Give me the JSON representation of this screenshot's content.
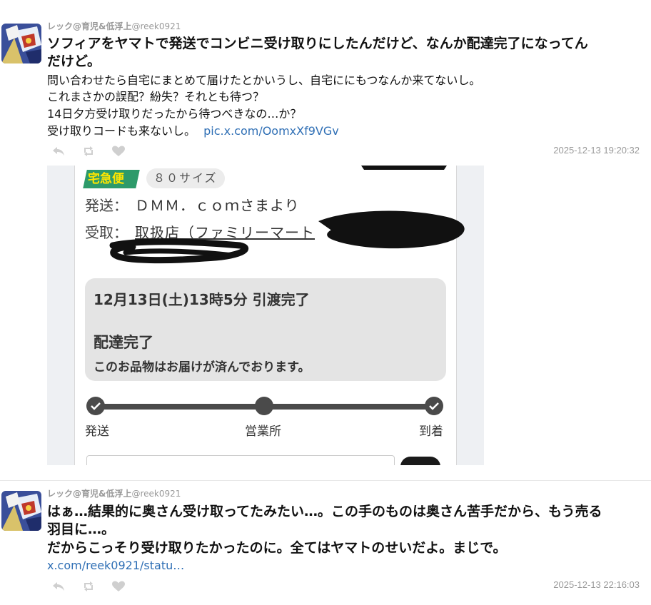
{
  "tweets": [
    {
      "author_name": "レック@育児&低浮上",
      "author_handle": "@reek0921",
      "bold_text_1": "ソフィアをヤマトで発送でコンビニ受け取りにしたんだけど、なんか配達完了になってん",
      "bold_text_2": "だけど。",
      "lines": [
        "問い合わせたら自宅にまとめて届けたとかいうし、自宅ににもつなんか来てないし。",
        "これまさかの誤配？紛失？それとも待つ？",
        "14日夕方受け取りだったから待つべきなの…か？"
      ],
      "last_line_text": "受け取りコードも来ないし。",
      "link": "pic.x.com/OomxXf9VGv",
      "timestamp": "2025-12-13 19:20:32",
      "actions": [
        "reply-icon",
        "retweet-icon",
        "like-icon"
      ]
    },
    {
      "author_name": "レック@育児&低浮上",
      "author_handle": "@reek0921",
      "bold_text_1": "はぁ…結果的に奥さん受け取ってたみたい…。この手のものは奥さん苦手だから、もう売る",
      "bold_text_2": "羽目に…。",
      "bold_text_3": "だからこっそり受け取りたかったのに。全てはヤマトのせいだよ。まじで。",
      "link": "x.com/reek0921/statu…",
      "timestamp": "2025-12-13 22:16:03",
      "actions": [
        "reply-icon",
        "retweet-icon",
        "like-icon"
      ]
    }
  ],
  "screenshot": {
    "badge": "宅急便",
    "size": "８０サイズ",
    "send_label": "発送：",
    "send_value": "ＤＭＭ．ｃｏｍさまより",
    "receive_label": "受取：",
    "receive_value": "取扱店（ファミリーマート",
    "status_time": "12月13日(土)13時5分 引渡完了",
    "status_main": "配達完了",
    "status_sub": "このお品物はお届けが済んでおります。",
    "steps": [
      "発送",
      "営業所",
      "到着"
    ],
    "progress_fraction": 1.0
  },
  "colors": {
    "link": "#2f6fb5",
    "badge_bg": "#2d9a6a",
    "badge_text": "#ffe600"
  }
}
